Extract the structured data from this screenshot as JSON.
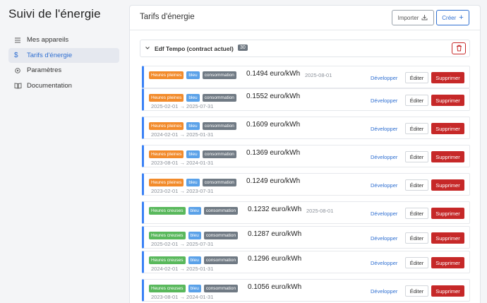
{
  "app": {
    "title": "Suivi de l'énergie"
  },
  "sidebar": {
    "items": [
      {
        "label": "Mes appareils",
        "icon": "lines-icon"
      },
      {
        "label": "Tarifs d'énergie",
        "icon": "dollar-icon",
        "active": true
      },
      {
        "label": "Paramètres",
        "icon": "gear-icon"
      },
      {
        "label": "Documentation",
        "icon": "book-icon"
      }
    ]
  },
  "main": {
    "title": "Tarifs d'énergie",
    "import_label": "Importer",
    "create_label": "Créer"
  },
  "group": {
    "title": "Edf Tempo (contract actuel)",
    "count": "30"
  },
  "row_labels": {
    "develop": "Développer",
    "edit": "Éditer",
    "delete": "Supprimer"
  },
  "rows": [
    {
      "period": "Heures pleines",
      "color": "bleu",
      "type": "consommation",
      "price": "0.1494 euro/kWh",
      "dates": "2025-08-01",
      "inline": true
    },
    {
      "period": "Heures pleines",
      "color": "bleu",
      "type": "consommation",
      "price": "0.1552 euro/kWh",
      "dates": "2025-02-01 → 2025-07-31",
      "inline": false
    },
    {
      "period": "Heures pleines",
      "color": "bleu",
      "type": "consommation",
      "price": "0.1609 euro/kWh",
      "dates": "2024-02-01 → 2025-01-31",
      "inline": false
    },
    {
      "period": "Heures pleines",
      "color": "bleu",
      "type": "consommation",
      "price": "0.1369 euro/kWh",
      "dates": "2023-08-01 → 2024-01-31",
      "inline": false
    },
    {
      "period": "Heures pleines",
      "color": "bleu",
      "type": "consommation",
      "price": "0.1249 euro/kWh",
      "dates": "2023-02-01 → 2023-07-31",
      "inline": false
    },
    {
      "period": "Heures creuses",
      "color": "bleu",
      "type": "consommation",
      "price": "0.1232 euro/kWh",
      "dates": "2025-08-01",
      "inline": true
    },
    {
      "period": "Heures creuses",
      "color": "bleu",
      "type": "consommation",
      "price": "0.1287 euro/kWh",
      "dates": "2025-02-01 → 2025-07-31",
      "inline": false
    },
    {
      "period": "Heures creuses",
      "color": "bleu",
      "type": "consommation",
      "price": "0.1296 euro/kWh",
      "dates": "2024-02-01 → 2025-01-31",
      "inline": false
    },
    {
      "period": "Heures creuses",
      "color": "bleu",
      "type": "consommation",
      "price": "0.1056 euro/kWh",
      "dates": "2023-08-01 → 2024-01-31",
      "inline": false
    }
  ],
  "colors": {
    "accent": "#2f6fd1",
    "danger": "#c62828",
    "peak": "#f28b2b",
    "offpeak": "#59b85c",
    "blue_tag": "#5aa1e8",
    "type_tag": "#707a84"
  }
}
